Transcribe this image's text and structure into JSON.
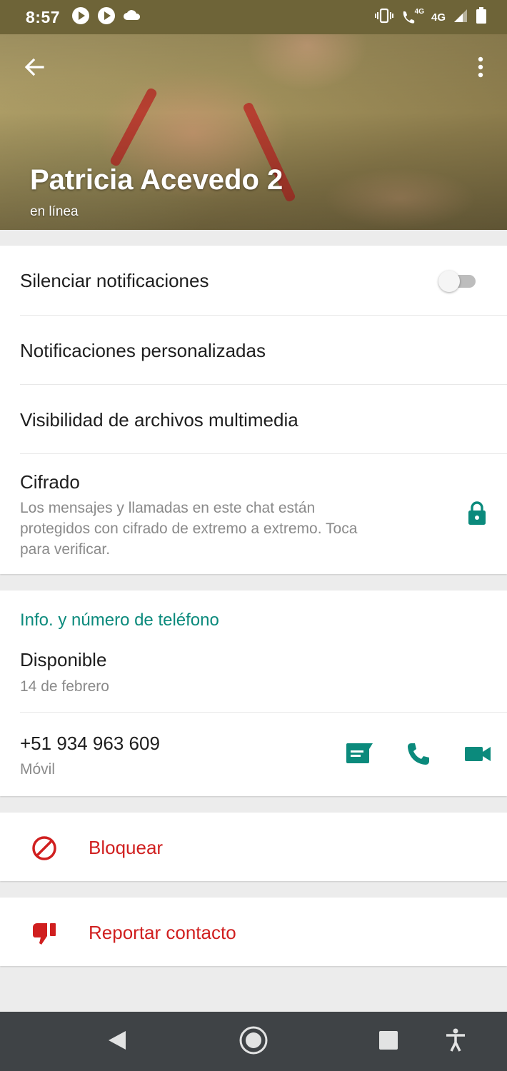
{
  "status_bar": {
    "time": "8:57",
    "left_icons": [
      "play-circle-icon",
      "play-circle-icon",
      "cloud-icon"
    ],
    "right_icons": [
      "vibrate-icon",
      "wifi-calling-icon",
      "signal-icon",
      "battery-icon"
    ],
    "call_network": "4G",
    "network": "4G"
  },
  "header": {
    "name": "Patricia Acevedo 2",
    "status": "en línea",
    "back_icon": "arrow-back-icon",
    "menu_icon": "more-vert-icon"
  },
  "settings": {
    "mute_label": "Silenciar notificaciones",
    "mute_enabled": false,
    "custom_notifications_label": "Notificaciones personalizadas",
    "media_visibility_label": "Visibilidad de archivos multimedia",
    "encryption_title": "Cifrado",
    "encryption_line1": "Los mensajes y llamadas en este chat están",
    "encryption_line2": "protegidos con cifrado de extremo a extremo. Toca",
    "encryption_line3": "para verificar.",
    "encryption_icon": "lock-icon"
  },
  "info": {
    "section_title": "Info. y número de teléfono",
    "about": "Disponible",
    "about_date": "14 de febrero",
    "phone": "+51 934 963 609",
    "phone_type": "Móvil",
    "icons": [
      "message-icon",
      "phone-icon",
      "videocam-icon"
    ]
  },
  "actions": {
    "block_label": "Bloquear",
    "block_icon": "block-icon",
    "report_label": "Reportar contacto",
    "report_icon": "thumb-down-icon"
  },
  "nav_bar": {
    "icons": [
      "nav-back-icon",
      "nav-home-icon",
      "nav-recents-icon",
      "accessibility-icon"
    ]
  },
  "colors": {
    "accent": "#0b8a7c",
    "danger": "#d01f1f",
    "status_bar": "#6e6438",
    "nav_bar": "#3f4346"
  }
}
